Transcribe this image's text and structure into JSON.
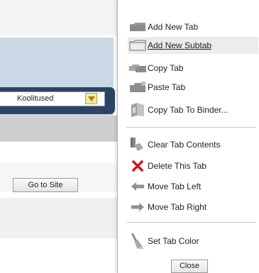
{
  "background": {
    "select_value": "Koolitused",
    "goto_site_label": "Go to Site"
  },
  "menu": {
    "items": [
      {
        "label": "Add New Tab",
        "icon": "add-tab-icon"
      },
      {
        "label": "Add New Subtab",
        "icon": "add-subtab-icon",
        "highlighted": true
      },
      {
        "label": "Copy Tab",
        "icon": "copy-tab-icon"
      },
      {
        "label": "Paste Tab",
        "icon": "paste-tab-icon"
      },
      {
        "label": "Copy Tab To Binder...",
        "icon": "binder-icon"
      },
      {
        "label": "Clear Tab Contents",
        "icon": "eraser-icon"
      },
      {
        "label": "Delete This Tab",
        "icon": "red-x-icon"
      },
      {
        "label": "Move Tab Left",
        "icon": "arrow-left-icon"
      },
      {
        "label": "Move Tab Right",
        "icon": "arrow-right-icon"
      },
      {
        "label": "Set Tab Color",
        "icon": "paint-brush-icon"
      }
    ],
    "close_label": "Close"
  },
  "colors": {
    "header_blue": "#cad8e6",
    "navy_bar": "#2c4462",
    "delete_red": "#d4121a",
    "icon_gray": "#8f8f8f"
  }
}
